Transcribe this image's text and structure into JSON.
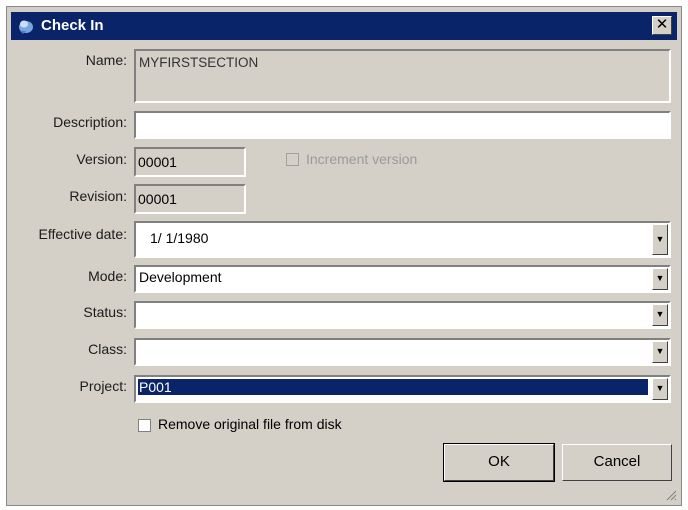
{
  "dialog": {
    "title": "Check In",
    "close_symbol": "✕",
    "icon": "check-in-icon"
  },
  "form": {
    "name_label": "Name:",
    "name_value": "MYFIRSTSECTION",
    "description_label": "Description:",
    "description_value": "",
    "version_label": "Version:",
    "version_value": "00001",
    "increment_label": "Increment version",
    "increment_checked": false,
    "revision_label": "Revision:",
    "revision_value": "00001",
    "effective_date_label": "Effective date:",
    "effective_date_value": "1/  1/1980",
    "mode_label": "Mode:",
    "mode_value": "Development",
    "status_label": "Status:",
    "status_value": "",
    "class_label": "Class:",
    "class_value": "",
    "project_label": "Project:",
    "project_value": "P001",
    "remove_label": "Remove original file from disk",
    "remove_checked": false
  },
  "buttons": {
    "ok": "OK",
    "cancel": "Cancel"
  },
  "colors": {
    "titlebar": "#0a246a",
    "dialog_bg": "#d4d0c8",
    "selection": "#0a246a"
  }
}
